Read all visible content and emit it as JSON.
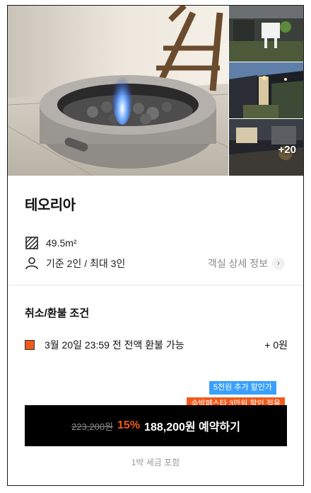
{
  "gallery": {
    "more_photos": "+20"
  },
  "room": {
    "name": "테오리아",
    "area": "49.5m²",
    "capacity": "기준 2인 / 최대 3인",
    "detail_link_label": "객실 상세 정보",
    "area_icon": "hatched-square-icon",
    "capacity_icon": "person-icon",
    "detail_icon": "chevron-right-icon"
  },
  "policy": {
    "title": "취소/환불 조건",
    "rule": "3월 20일 23:59 전 전액 환불 가능",
    "fee": "+ 0원",
    "marker_color": "#f05a1a"
  },
  "promo": {
    "extra_discount": "5천원 추가 할인가",
    "festival_discount": "숙박페스타 3만원 할인 적용"
  },
  "booking": {
    "original_price": "223,200원",
    "discount_rate": "15%",
    "label": "188,200원 예약하기",
    "tax_note": "1박 세금 포함"
  },
  "colors": {
    "accent_orange": "#f05a1a",
    "accent_blue": "#3aa0ff",
    "button_bg": "#000000"
  }
}
